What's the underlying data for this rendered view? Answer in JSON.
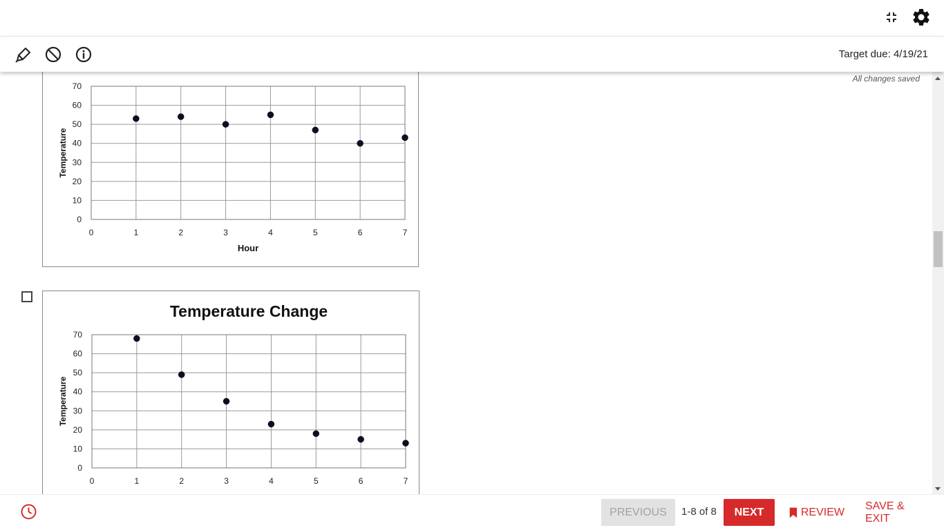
{
  "header": {
    "minimize_icon": "minimize-icon",
    "settings_icon": "gear-icon"
  },
  "toolbar": {
    "tools": [
      "highlighter-icon",
      "eliminate-icon",
      "info-icon"
    ],
    "target_due": "Target due: 4/19/21"
  },
  "status": {
    "saved_text": "All changes saved"
  },
  "chart_data": [
    {
      "type": "scatter",
      "title": "",
      "xlabel": "Hour",
      "ylabel": "Temperature",
      "x": [
        1,
        2,
        3,
        4,
        5,
        6,
        7
      ],
      "y": [
        53,
        54,
        50,
        55,
        47,
        40,
        43
      ],
      "xlim": [
        0,
        7
      ],
      "ylim": [
        0,
        70
      ],
      "xticks": [
        "0",
        "1",
        "2",
        "3",
        "4",
        "5",
        "6",
        "7"
      ],
      "yticks": [
        "0",
        "10",
        "20",
        "30",
        "40",
        "50",
        "60",
        "70"
      ],
      "grid": true
    },
    {
      "type": "scatter",
      "title": "Temperature Change",
      "xlabel": "",
      "ylabel": "Temperature",
      "x": [
        1,
        2,
        3,
        4,
        5,
        6,
        7
      ],
      "y": [
        68,
        49,
        35,
        23,
        18,
        15,
        13
      ],
      "xlim": [
        0,
        7
      ],
      "ylim": [
        0,
        70
      ],
      "xticks": [
        "0",
        "1",
        "2",
        "3",
        "4",
        "5",
        "6",
        "7"
      ],
      "yticks": [
        "0",
        "10",
        "20",
        "30",
        "40",
        "50",
        "60",
        "70"
      ],
      "grid": true
    }
  ],
  "footer": {
    "clock_icon": "clock-icon",
    "previous_label": "PREVIOUS",
    "page_count": "1-8 of 8",
    "next_label": "NEXT",
    "review_label": "REVIEW",
    "save_exit_label": "SAVE & EXIT",
    "accent_color": "#d62a2a"
  }
}
